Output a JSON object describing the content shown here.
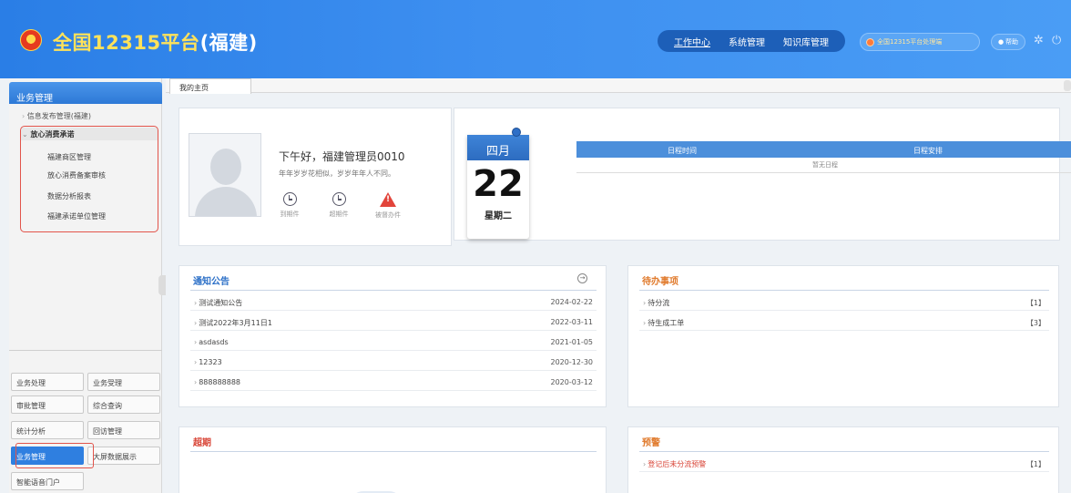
{
  "header": {
    "title_main": "全国12315平台",
    "title_sub": "(福建)",
    "nav": [
      "工作中心",
      "系统管理",
      "知识库管理"
    ],
    "active_nav": "工作中心",
    "user_label": "全国12315平台处理端",
    "help_label": "帮助"
  },
  "sidebar": {
    "title": "业务管理",
    "items": [
      {
        "label": "信息发布管理(福建)"
      },
      {
        "label": "放心消费承诺"
      }
    ],
    "subitems": [
      "福建商区管理",
      "放心消费备案审核",
      "数据分析报表",
      "福建承诺单位管理"
    ],
    "modules": [
      [
        "业务处理",
        "业务受理"
      ],
      [
        "审批管理",
        "综合查询"
      ],
      [
        "统计分析",
        "回访管理"
      ],
      [
        "业务管理",
        "大屏数据展示"
      ],
      [
        "智能语音门户",
        ""
      ]
    ],
    "active_module": "业务管理"
  },
  "tabs": [
    "我的主页"
  ],
  "profile": {
    "greeting": "下午好，福建管理员0010",
    "motto": "年年岁岁花相似，岁岁年年人不同。",
    "stats": [
      "到期件",
      "超期件",
      "被督办件"
    ]
  },
  "calendar": {
    "month": "四月",
    "day": "22",
    "weekday": "星期二"
  },
  "schedule": {
    "headers": [
      "日程时间",
      "日程安排"
    ],
    "empty_text": "暂无日程"
  },
  "notice": {
    "title": "通知公告",
    "rows": [
      {
        "title": "测试通知公告",
        "date": "2024-02-22"
      },
      {
        "title": "测试2022年3月11日1",
        "date": "2022-03-11"
      },
      {
        "title": "asdasds",
        "date": "2021-01-05"
      },
      {
        "title": "12323",
        "date": "2020-12-30"
      },
      {
        "title": "888888888",
        "date": "2020-03-12"
      }
    ]
  },
  "todo": {
    "title": "待办事项",
    "rows": [
      {
        "title": "待分流",
        "count": "【1】"
      },
      {
        "title": "待生成工单",
        "count": "【3】"
      }
    ]
  },
  "overdue": {
    "title": "超期"
  },
  "warning": {
    "title": "预警",
    "rows": [
      {
        "title": "登记后未分流预警",
        "count": "【1】"
      }
    ]
  },
  "colors": {
    "header_blue": "#3d8ff0",
    "title_yellow": "#ffe25a",
    "accent_blue": "#2f7fe0",
    "highlight_red": "#e2544b"
  }
}
